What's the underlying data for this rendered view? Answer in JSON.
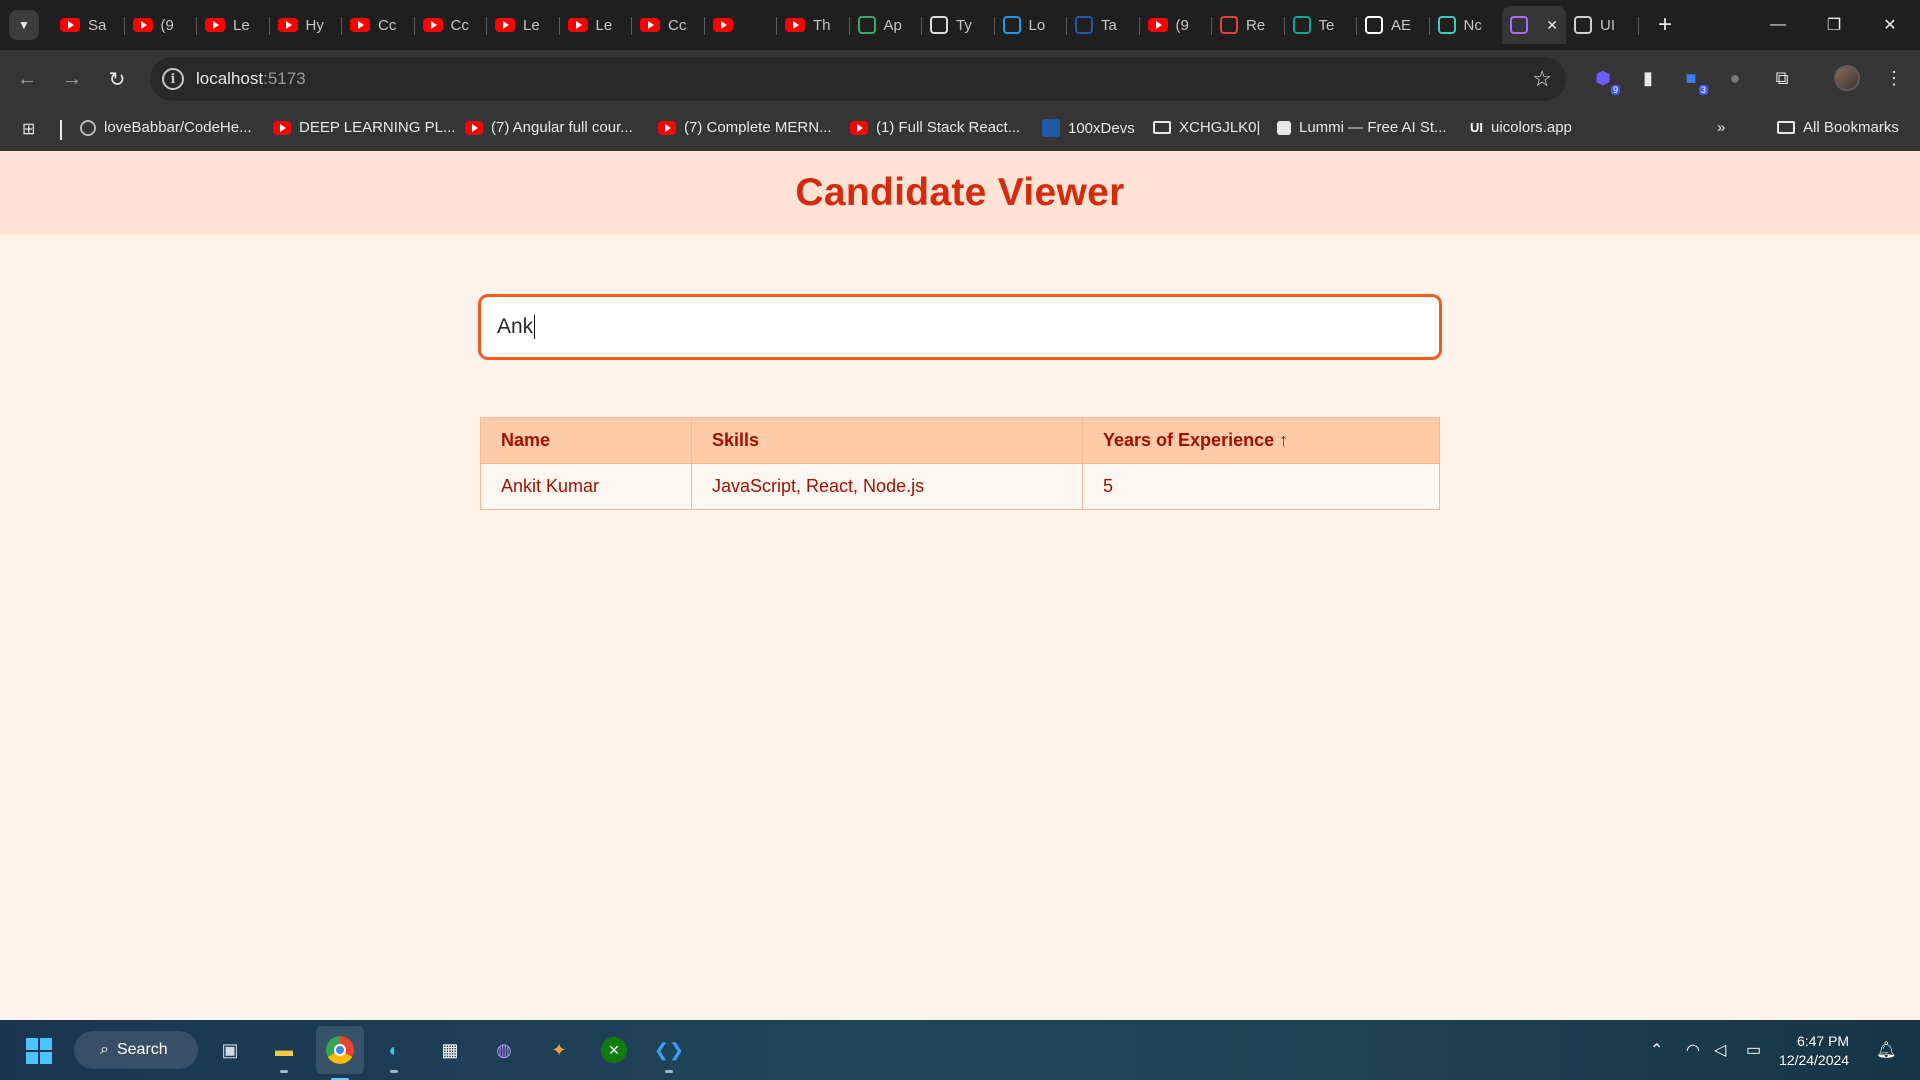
{
  "browser": {
    "tabs": [
      {
        "label": "Sa",
        "icon": "youtube-icon"
      },
      {
        "label": "(9",
        "icon": "youtube-icon"
      },
      {
        "label": "Le",
        "icon": "youtube-icon"
      },
      {
        "label": "Hy",
        "icon": "youtube-icon"
      },
      {
        "label": "Cc",
        "icon": "youtube-icon"
      },
      {
        "label": "Cc",
        "icon": "youtube-icon"
      },
      {
        "label": "Le",
        "icon": "youtube-icon"
      },
      {
        "label": "Le",
        "icon": "youtube-icon"
      },
      {
        "label": "Cc",
        "icon": "youtube-icon"
      },
      {
        "label": "",
        "icon": "youtube-icon"
      },
      {
        "label": "Th",
        "icon": "youtube-icon"
      },
      {
        "label": "Ap",
        "icon": "leaf-icon"
      },
      {
        "label": "Ty",
        "icon": "document-icon"
      },
      {
        "label": "Lo",
        "icon": "t-logo-icon"
      },
      {
        "label": "Ta",
        "icon": "avatar-icon"
      },
      {
        "label": "(9",
        "icon": "youtube-icon"
      },
      {
        "label": "Re",
        "icon": "gmail-icon"
      },
      {
        "label": "Te",
        "icon": "teams-icon"
      },
      {
        "label": "AE",
        "icon": "notion-icon"
      },
      {
        "label": "Nc",
        "icon": "globe-icon"
      },
      {
        "label": "",
        "icon": "vite-icon",
        "active": true
      },
      {
        "label": "UI",
        "icon": "openai-icon"
      }
    ],
    "url_host": "localhost",
    "url_port": ":5173",
    "bookmarks": [
      {
        "label": "loveBabbar/CodeHe...",
        "icon": "github-icon"
      },
      {
        "label": "DEEP LEARNING PL...",
        "icon": "youtube-icon"
      },
      {
        "label": "(7) Angular full cour...",
        "icon": "youtube-icon"
      },
      {
        "label": "(7) Complete MERN...",
        "icon": "youtube-icon"
      },
      {
        "label": "(1) Full Stack React...",
        "icon": "youtube-icon"
      },
      {
        "label": "100xDevs",
        "icon": "avatar-icon"
      },
      {
        "label": "XCHGJLK0|",
        "icon": "folder-icon"
      },
      {
        "label": "Lummi — Free AI St...",
        "icon": "lummi-icon"
      },
      {
        "label": "uicolors.app",
        "icon": "ui-logo-icon"
      }
    ],
    "all_bookmarks": "All Bookmarks",
    "extension_badges": {
      "ext1": "9",
      "ext3": "3"
    }
  },
  "app": {
    "title": "Candidate Viewer",
    "search_value": "Ank",
    "table": {
      "headers": {
        "name": "Name",
        "skills": "Skills",
        "experience": "Years of Experience ↑"
      },
      "rows": [
        {
          "name": "Ankit Kumar",
          "skills": "JavaScript, React, Node.js",
          "experience": "5"
        }
      ]
    }
  },
  "taskbar": {
    "search_label": "Search",
    "time": "6:47 PM",
    "date": "12/24/2024"
  },
  "colors": {
    "header_bg": "#ffe4d6",
    "page_bg": "#fff4ec",
    "title": "#d42b0f",
    "accent_border": "#f35c21",
    "table_header_bg": "#ffcba8",
    "table_text": "#a31000"
  }
}
